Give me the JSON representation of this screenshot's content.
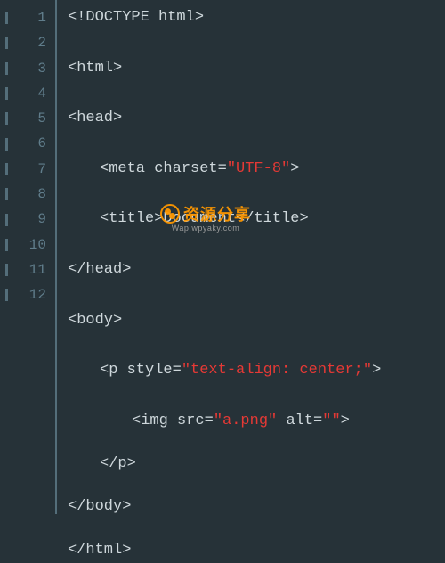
{
  "gutter": {
    "lines": [
      "1",
      "2",
      "3",
      "4",
      "5",
      "6",
      "7",
      "8",
      "9",
      "10",
      "11",
      "12"
    ]
  },
  "code": {
    "l1": {
      "t": "<!DOCTYPE html>"
    },
    "l2": {
      "t": "<html>"
    },
    "l3": {
      "t": "<head>"
    },
    "l4": {
      "open": "<meta charset=",
      "val": "\"UTF-8\"",
      "close": ">"
    },
    "l5": {
      "open": "<title>",
      "txt": "Document",
      "close": "</title>"
    },
    "l6": {
      "t": "</head>"
    },
    "l7": {
      "t": "<body>"
    },
    "l8": {
      "open": "<p style=",
      "val": "\"text-align: center;\"",
      "close": ">"
    },
    "l9": {
      "open": "<img src=",
      "v1": "\"a.png\"",
      "mid": " alt=",
      "v2": "\"\"",
      "close": ">"
    },
    "l10": {
      "t": "</p>"
    },
    "l11": {
      "t": "</body>"
    },
    "l12": {
      "t": "</html>"
    }
  },
  "watermark": {
    "title": "资源分享",
    "sub": "Wap.wpyaky.com"
  }
}
